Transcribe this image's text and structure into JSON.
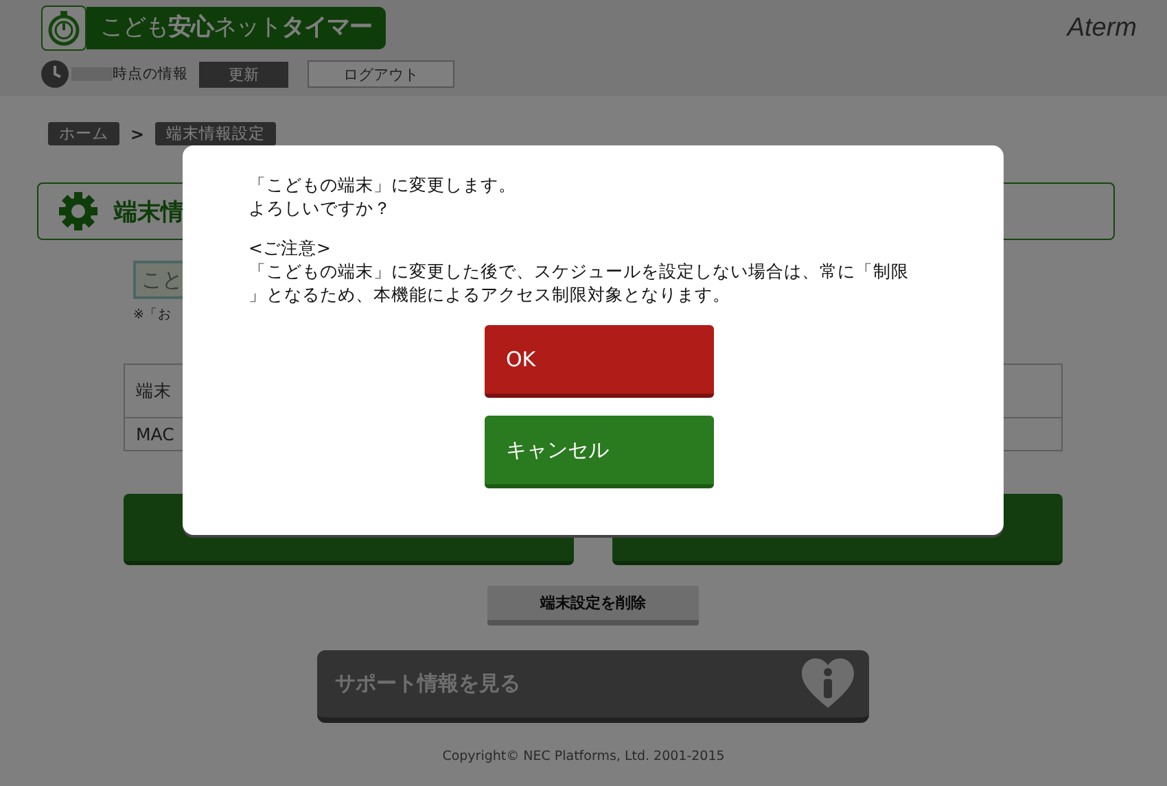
{
  "header": {
    "title": "こども**安心**ネット**タイマー**",
    "info_label": "時点の情報",
    "refresh_button": "更新",
    "logout_button": "ログアウト",
    "brand": "Aterm"
  },
  "breadcrumb": {
    "items": [
      {
        "label": "ホーム"
      },
      {
        "label": "端末情報設定"
      }
    ],
    "separator": ">"
  },
  "section": {
    "title": "端末情"
  },
  "name_field": {
    "value": "こと",
    "note": "※「お"
  },
  "table": {
    "rows": [
      {
        "label": "端末"
      },
      {
        "label": "MAC"
      }
    ]
  },
  "delete_button": "端末設定を削除",
  "support_button": "サポート情報を見る",
  "copyright": "Copyright© NEC Platforms, Ltd. 2001-2015",
  "dialog": {
    "message": [
      "「こどもの端末」に変更します。",
      "よろしいですか？"
    ],
    "note_title": "<ご注意>",
    "note": [
      "「こどもの端末」に変更した後で、スケジュールを設定しない場合は、常に「制限",
      "」となるため、本機能によるアクセス制限対象となります。"
    ],
    "buttons": [
      {
        "label": "OK",
        "kind": "confirm"
      },
      {
        "label": "キャンセル",
        "kind": "cancel"
      }
    ]
  }
}
